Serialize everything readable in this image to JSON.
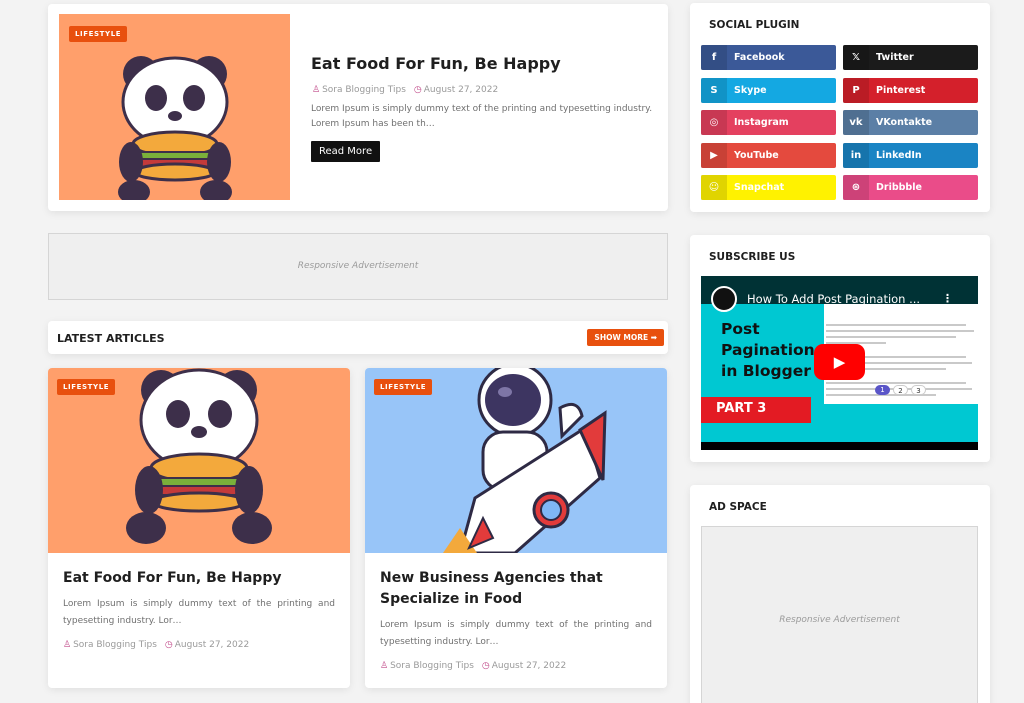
{
  "featured": {
    "badge": "LIFESTYLE",
    "title": "Eat Food For Fun, Be Happy",
    "author": "Sora Blogging Tips",
    "date": "August 27, 2022",
    "excerpt": "Lorem Ipsum is simply dummy text of the printing and typesetting industry. Lorem Ipsum has been th…",
    "read_more": "Read More"
  },
  "ads": {
    "responsive_text": "Responsive Advertisement"
  },
  "latest": {
    "heading": "LATEST ARTICLES",
    "show_more": "SHOW MORE ➡",
    "articles": [
      {
        "badge": "LIFESTYLE",
        "title": "Eat Food For Fun, Be Happy",
        "excerpt": "Lorem Ipsum is simply dummy text of the printing and typesetting industry. Lor…",
        "author": "Sora Blogging Tips",
        "date": "August 27, 2022"
      },
      {
        "badge": "LIFESTYLE",
        "title": "New Business Agencies that Specialize in Food",
        "excerpt": "Lorem Ipsum is simply dummy text of the printing and typesetting industry. Lor…",
        "author": "Sora Blogging Tips",
        "date": "August 27, 2022"
      }
    ]
  },
  "sidebar": {
    "social": {
      "title": "SOCIAL PLUGIN",
      "buttons": [
        {
          "label": "Facebook",
          "icon": "facebook-icon",
          "glyph": "f",
          "color": "#3b5998"
        },
        {
          "label": "Twitter",
          "icon": "x-twitter-icon",
          "glyph": "𝕏",
          "color": "#1b1b1b"
        },
        {
          "label": "Skype",
          "icon": "skype-icon",
          "glyph": "S",
          "color": "#14a8e2"
        },
        {
          "label": "Pinterest",
          "icon": "pinterest-icon",
          "glyph": "P",
          "color": "#d4202b"
        },
        {
          "label": "Instagram",
          "icon": "instagram-icon",
          "glyph": "◎",
          "color": "#e4405f"
        },
        {
          "label": "VKontakte",
          "icon": "vk-icon",
          "glyph": "vk",
          "color": "#5b7fa6"
        },
        {
          "label": "YouTube",
          "icon": "youtube-icon",
          "glyph": "▶",
          "color": "#e44a3e"
        },
        {
          "label": "LinkedIn",
          "icon": "linkedin-icon",
          "glyph": "in",
          "color": "#1a84c4"
        },
        {
          "label": "Snapchat",
          "icon": "snapchat-icon",
          "glyph": "☺",
          "color": "#fff200"
        },
        {
          "label": "Dribbble",
          "icon": "dribbble-icon",
          "glyph": "⊛",
          "color": "#ea4c89"
        }
      ]
    },
    "subscribe": {
      "title": "SUBSCRIBE US",
      "video_title": "How To Add Post Pagination ...",
      "thumb_text": "Post Pagination in Blogger",
      "part_label": "PART 3",
      "pages": [
        "1",
        "2",
        "3"
      ]
    },
    "adspace": {
      "title": "AD SPACE"
    }
  }
}
